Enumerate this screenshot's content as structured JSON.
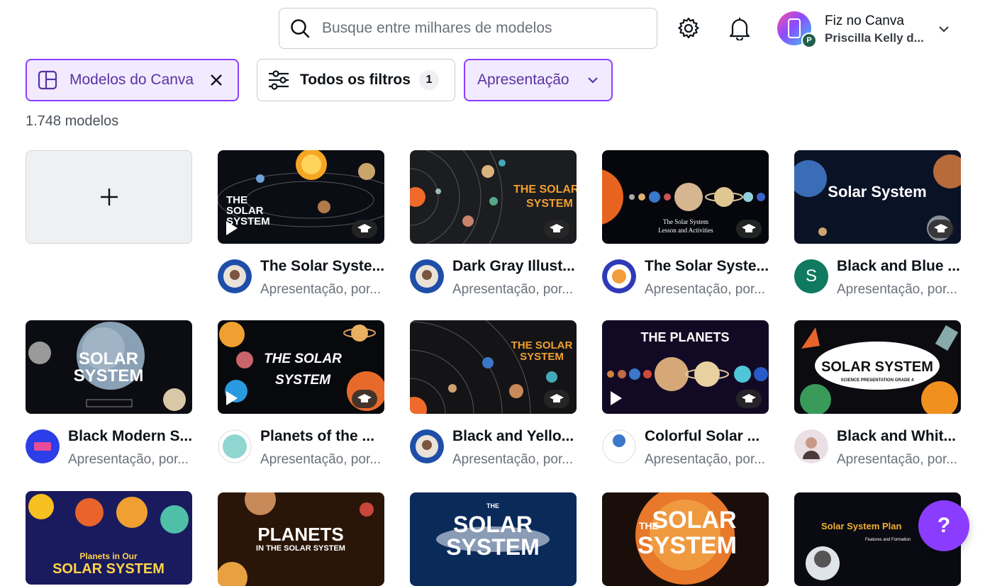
{
  "search": {
    "placeholder": "Busque entre milhares de modelos"
  },
  "account": {
    "title": "Fiz no Canva",
    "subtitle": "Priscilla Kelly d...",
    "badge": "P"
  },
  "filters": {
    "canva_chip": "Modelos do Canva",
    "all_filters": "Todos os filtros",
    "all_filters_count": "1",
    "presentation_chip": "Apresentação"
  },
  "results": {
    "count_label": "1.748 modelos"
  },
  "templates": [
    {
      "title": "The Solar Syste...",
      "subtitle": "Apresentação, por...",
      "thumb_text": [
        "THE",
        "SOLAR",
        "SYSTEM"
      ]
    },
    {
      "title": "Dark Gray Illust...",
      "subtitle": "Apresentação, por...",
      "thumb_text": [
        "THE SOLAR",
        "SYSTEM"
      ]
    },
    {
      "title": "The Solar Syste...",
      "subtitle": "Apresentação, por...",
      "thumb_text": [
        "The Solar System",
        "Lesson and Activities"
      ]
    },
    {
      "title": "Black and Blue ...",
      "subtitle": "Apresentação, por...",
      "thumb_text": [
        "Solar System"
      ],
      "creator_initial": "S"
    },
    {
      "title": "Black Modern S...",
      "subtitle": "Apresentação, por...",
      "thumb_text": [
        "SOLAR",
        "SYSTEM"
      ]
    },
    {
      "title": "Planets of the ...",
      "subtitle": "Apresentação, por...",
      "thumb_text": [
        "THE SOLAR",
        "SYSTEM"
      ]
    },
    {
      "title": "Black and Yello...",
      "subtitle": "Apresentação, por...",
      "thumb_text": [
        "THE SOLAR",
        "SYSTEM"
      ]
    },
    {
      "title": "Colorful Solar ...",
      "subtitle": "Apresentação, por...",
      "thumb_text": [
        "THE PLANETS"
      ]
    },
    {
      "title": "Black and Whit...",
      "subtitle": "Apresentação, por...",
      "thumb_text": [
        "SOLAR SYSTEM",
        "SCIENCE PRESENTATION GRADE 4"
      ]
    },
    {
      "thumb_text": [
        "Planets in Our",
        "SOLAR SYSTEM"
      ]
    },
    {
      "thumb_text": [
        "PLANETS",
        "IN THE SOLAR SYSTEM"
      ]
    },
    {
      "thumb_text": [
        "THE",
        "SOLAR",
        "SYSTEM"
      ]
    },
    {
      "thumb_text": [
        "THE",
        "SOLAR",
        "SYSTEM"
      ]
    },
    {
      "thumb_text": [
        "Solar System Plan",
        "Features and Formation"
      ]
    }
  ],
  "help": {
    "label": "?"
  }
}
